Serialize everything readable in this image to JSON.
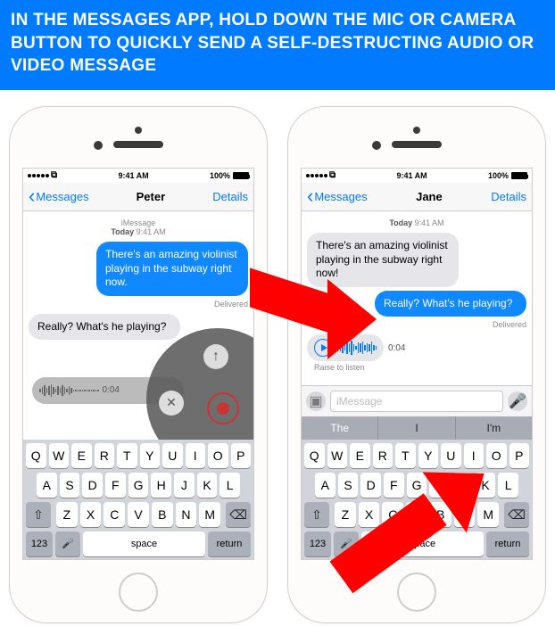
{
  "banner": "In the Messages App, hold down the mic or camera button to quickly send a self-destructing audio or video message",
  "status": {
    "time": "9:41 AM",
    "battery": "100%"
  },
  "nav": {
    "back": "Messages",
    "details": "Details"
  },
  "left": {
    "contact": "Peter",
    "header_label": "iMessage",
    "timestamp": "Today 9:41 AM",
    "sent": "There's an amazing violinist playing in the subway right now.",
    "delivered": "Delivered",
    "recv": "Really? What's he playing?",
    "audio_time": "0:04"
  },
  "right": {
    "contact": "Jane",
    "timestamp": "Today 9:41 AM",
    "recv": "There's an amazing violinist playing in the subway right now!",
    "sent": "Really? What's he playing?",
    "delivered": "Delivered",
    "audio_time": "0:04",
    "raise": "Raise to listen",
    "placeholder": "iMessage",
    "predict": [
      "The",
      "I",
      "I'm"
    ]
  },
  "keys": {
    "r1": [
      "Q",
      "W",
      "E",
      "R",
      "T",
      "Y",
      "U",
      "I",
      "O",
      "P"
    ],
    "r2": [
      "A",
      "S",
      "D",
      "F",
      "G",
      "H",
      "J",
      "K",
      "L"
    ],
    "r3": [
      "Z",
      "X",
      "C",
      "V",
      "B",
      "N",
      "M"
    ],
    "num": "123",
    "space": "space",
    "ret": "return"
  }
}
